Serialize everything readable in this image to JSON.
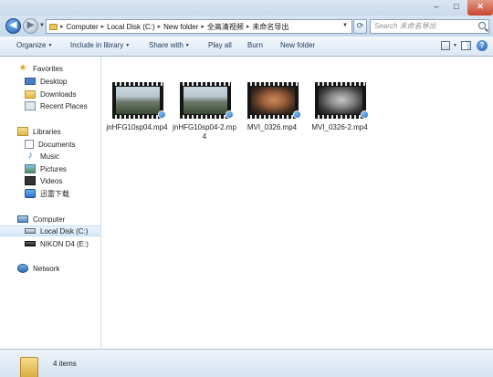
{
  "window": {
    "minimize_glyph": "–",
    "maximize_glyph": "□",
    "close_glyph": "✕"
  },
  "address": {
    "crumbs": [
      "Computer",
      "Local Disk (C:)",
      "New folder",
      "全高清视频",
      "未命名导出"
    ],
    "search_placeholder": "Search 未命名导出"
  },
  "toolbar": {
    "organize": "Organize",
    "include_in_library": "Include in library",
    "share_with": "Share with",
    "play_all": "Play all",
    "burn": "Burn",
    "new_folder": "New folder"
  },
  "nav": {
    "favorites": "Favorites",
    "desktop": "Desktop",
    "downloads": "Downloads",
    "recent_places": "Recent Places",
    "libraries": "Libraries",
    "documents": "Documents",
    "music": "Music",
    "pictures": "Pictures",
    "videos": "Videos",
    "xunlei": "迅雷下载",
    "computer": "Computer",
    "local_disk": "Local Disk (C:)",
    "nikon": "NIKON D4 (E:)",
    "network": "Network"
  },
  "files": [
    {
      "name": "jnHFG10sp04.mp4",
      "thumb": "city"
    },
    {
      "name": "jnHFG10sp04-2.mp4",
      "thumb": "city"
    },
    {
      "name": "MVI_0326.mp4",
      "thumb": "face"
    },
    {
      "name": "MVI_0326-2.mp4",
      "thumb": "face-gray"
    }
  ],
  "status": {
    "item_count": "4 items"
  },
  "colors": {
    "chrome": "#d7e4f3",
    "selection": "#d6e7f9",
    "close_button": "#c9452c"
  }
}
